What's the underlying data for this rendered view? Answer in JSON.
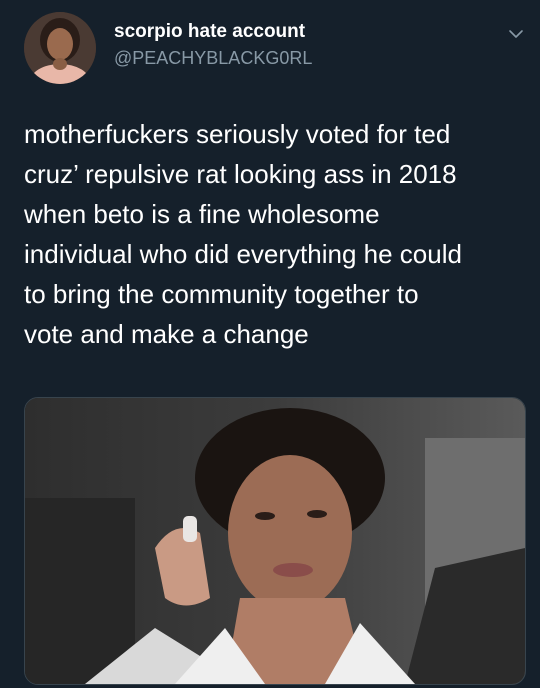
{
  "header": {
    "display_name": "scorpio hate account",
    "handle": "@PEACHYBLACKG0RL"
  },
  "tweet": {
    "lines": [
      "motherfuckers seriously voted for ted",
      "cruz’ repulsive rat looking ass in 2018",
      "when beto is a fine wholesome",
      "individual who did everything he could",
      "to bring the community together to",
      "vote and make a change"
    ]
  },
  "icons": {
    "menu": "chevron-down-icon",
    "avatar": "profile-photo"
  },
  "colors": {
    "background": "#15202b",
    "text": "#ffffff",
    "secondary_text": "#8899a6"
  }
}
